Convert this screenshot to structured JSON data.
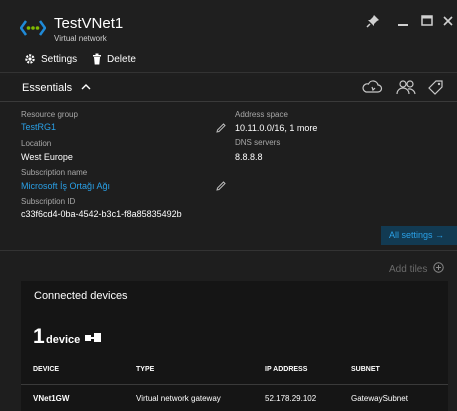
{
  "header": {
    "title": "TestVNet1",
    "subtitle": "Virtual network",
    "settings_label": "Settings",
    "delete_label": "Delete"
  },
  "essentials": {
    "label": "Essentials",
    "resource_group_label": "Resource group",
    "resource_group_value": "TestRG1",
    "location_label": "Location",
    "location_value": "West Europe",
    "subscription_name_label": "Subscription name",
    "subscription_name_value": "Microsoft İş Ortağı Ağı",
    "subscription_id_label": "Subscription ID",
    "subscription_id_value": "c33f6cd4-0ba-4542-b3c1-f8a85835492b",
    "address_space_label": "Address space",
    "address_space_value": "10.11.0.0/16, 1 more",
    "dns_servers_label": "DNS servers",
    "dns_servers_value": "8.8.8.8",
    "all_settings_label": "All settings →"
  },
  "tiles": {
    "add_tiles_label": "Add tiles",
    "connected_devices": {
      "title": "Connected devices",
      "count": "1",
      "count_unit": "device",
      "columns": [
        "DEVICE",
        "TYPE",
        "IP ADDRESS",
        "SUBNET"
      ],
      "row": {
        "device": "VNet1GW",
        "type": "Virtual network gateway",
        "ip": "52.178.29.102",
        "subnet": "GatewaySubnet"
      }
    }
  }
}
